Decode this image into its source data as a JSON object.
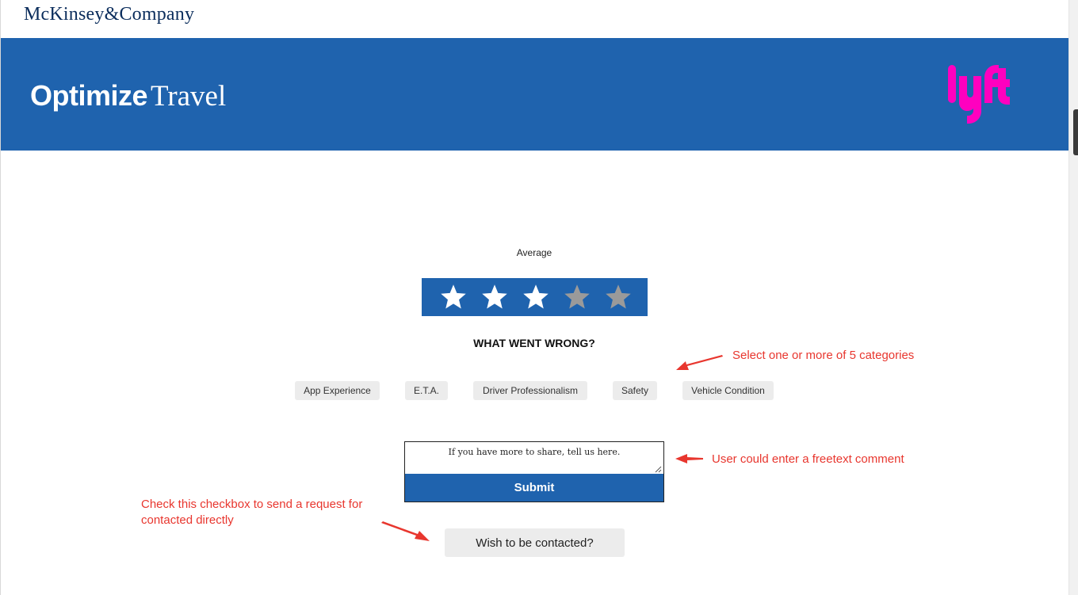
{
  "header": {
    "brand": "McKinsey&Company"
  },
  "hero": {
    "title_bold": "Optimize",
    "title_light": "Travel",
    "logo": "lyft"
  },
  "rating": {
    "label": "Average",
    "value": 3,
    "max": 5,
    "star_icon": "star-icon",
    "filled_color": "#ffffff",
    "empty_color": "#9a9a9a"
  },
  "feedback": {
    "question": "WHAT WENT WRONG?",
    "categories": [
      "App Experience",
      "E.T.A.",
      "Driver Professionalism",
      "Safety",
      "Vehicle Condition"
    ],
    "comment_placeholder": "If you have more to share, tell us here.",
    "submit_label": "Submit",
    "contact_label": "Wish to be contacted?"
  },
  "annotations": {
    "categories_note": "Select one or more of 5 categories",
    "comment_note": "User could enter a freetext comment",
    "contact_note": "Check this checkbox to send a request for contacted directly"
  },
  "colors": {
    "brand_blue": "#1f63ae",
    "lyft_pink": "#ff00bf",
    "annotation_red": "#e8362e",
    "chip_bg": "#ececec"
  }
}
